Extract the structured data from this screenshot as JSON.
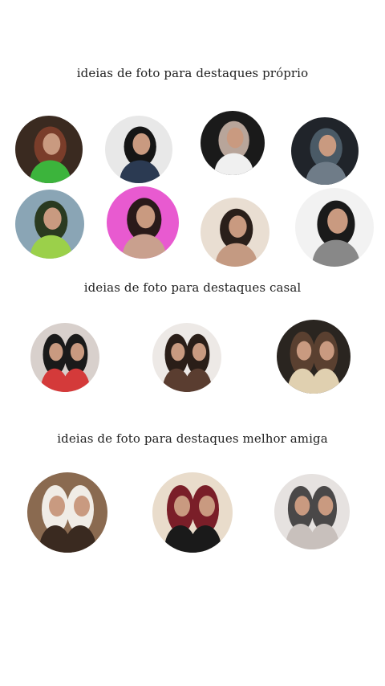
{
  "sections": [
    {
      "heading": "ideias de foto para destaques próprio",
      "photos": [
        {
          "icon": "photo-selfie-icon",
          "colors": [
            "#3a2a20",
            "#7a3d2a",
            "#3cb43c"
          ]
        },
        {
          "icon": "photo-selfie-icon",
          "colors": [
            "#e8e8e8",
            "#151515",
            "#2b3a52"
          ]
        },
        {
          "icon": "photo-selfie-icon",
          "colors": [
            "#1a1a1a",
            "#b8a59a",
            "#f0f0f0"
          ]
        },
        {
          "icon": "photo-selfie-icon",
          "colors": [
            "#20242a",
            "#4a5a66",
            "#6f7c88"
          ]
        },
        {
          "icon": "photo-selfie-icon",
          "colors": [
            "#8aa5b5",
            "#2a3a20",
            "#9bd04a"
          ]
        },
        {
          "icon": "photo-selfie-icon",
          "colors": [
            "#e85ad0",
            "#2a1a1a",
            "#c9a08e"
          ]
        },
        {
          "icon": "photo-selfie-icon",
          "colors": [
            "#e9ded2",
            "#2a1f1a",
            "#c49a82"
          ]
        },
        {
          "icon": "photo-selfie-icon",
          "colors": [
            "#f2f2f2",
            "#1a1a1a",
            "#888888"
          ]
        }
      ]
    },
    {
      "heading": "ideias de foto para destaques casal",
      "photos": [
        {
          "icon": "photo-couple-icon",
          "colors": [
            "#d8d0cc",
            "#1a1a1a",
            "#d43a3a"
          ]
        },
        {
          "icon": "photo-couple-icon",
          "colors": [
            "#ede9e6",
            "#2a1e18",
            "#5a3d30"
          ]
        },
        {
          "icon": "photo-couple-icon",
          "colors": [
            "#2a2520",
            "#5a4030",
            "#e0d0b0"
          ]
        }
      ]
    },
    {
      "heading": "ideias de foto para destaques melhor amiga",
      "photos": [
        {
          "icon": "photo-friends-icon",
          "colors": [
            "#8a6a50",
            "#f0ece6",
            "#3a2a20"
          ]
        },
        {
          "icon": "photo-friends-icon",
          "colors": [
            "#e9dccb",
            "#7a1e28",
            "#1a1a1a"
          ]
        },
        {
          "icon": "photo-friends-icon",
          "colors": [
            "#e6e2e0",
            "#4a4848",
            "#c8c0bc"
          ]
        }
      ]
    }
  ]
}
